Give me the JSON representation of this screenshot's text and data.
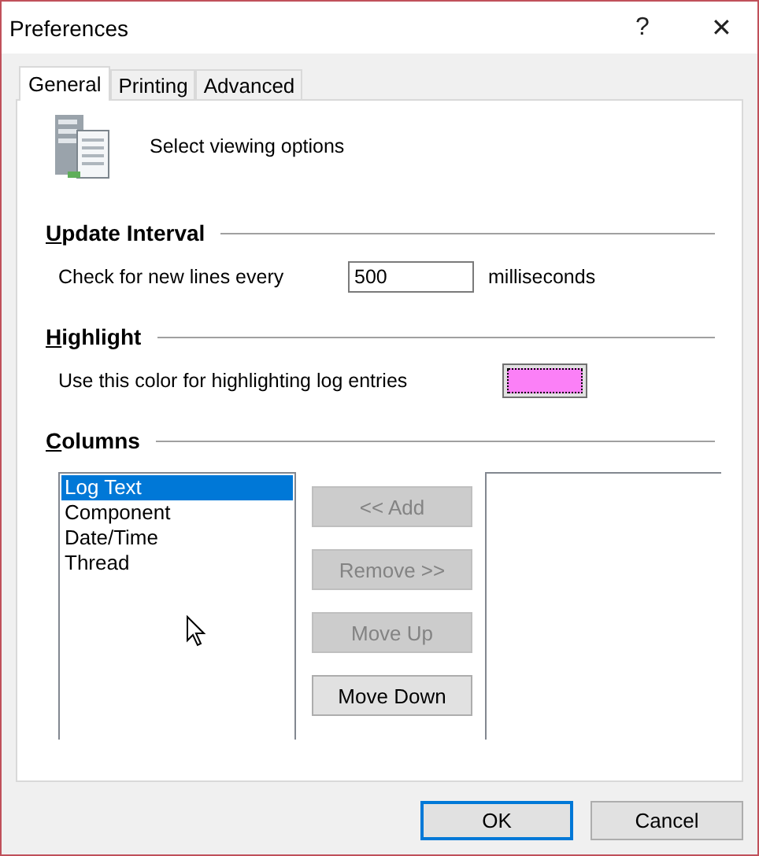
{
  "window": {
    "title": "Preferences",
    "help": "?",
    "close": "✕"
  },
  "tabs": [
    {
      "label": "General",
      "selected": true
    },
    {
      "label": "Printing",
      "selected": false
    },
    {
      "label": "Advanced",
      "selected": false
    }
  ],
  "header": {
    "text": "Select viewing options"
  },
  "update_interval": {
    "heading": "Update Interval",
    "label": "Check for new lines every",
    "value": "500",
    "unit": "milliseconds"
  },
  "highlight": {
    "heading": "Highlight",
    "label": "Use this color for highlighting log entries",
    "color": "#fb80f7"
  },
  "columns": {
    "heading": "Columns",
    "available": [
      {
        "label": "Log Text",
        "selected": true
      },
      {
        "label": "Component",
        "selected": false
      },
      {
        "label": "Date/Time",
        "selected": false
      },
      {
        "label": "Thread",
        "selected": false
      }
    ],
    "buttons": [
      {
        "label": "<< Add",
        "disabled": true
      },
      {
        "label": "Remove >>",
        "disabled": true
      },
      {
        "label": "Move Up",
        "disabled": true
      },
      {
        "label": "Move Down",
        "disabled": false
      }
    ]
  },
  "buttons": [
    {
      "label": "OK",
      "default": true
    },
    {
      "label": "Cancel",
      "default": false
    }
  ]
}
